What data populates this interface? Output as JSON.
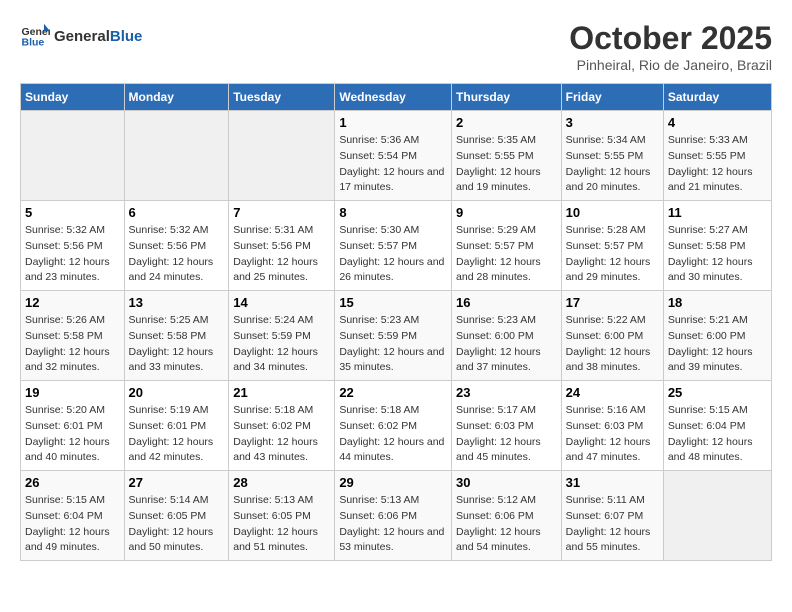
{
  "header": {
    "logo_general": "General",
    "logo_blue": "Blue",
    "title": "October 2025",
    "subtitle": "Pinheiral, Rio de Janeiro, Brazil"
  },
  "calendar": {
    "days_of_week": [
      "Sunday",
      "Monday",
      "Tuesday",
      "Wednesday",
      "Thursday",
      "Friday",
      "Saturday"
    ],
    "weeks": [
      [
        {
          "day": "",
          "info": ""
        },
        {
          "day": "",
          "info": ""
        },
        {
          "day": "",
          "info": ""
        },
        {
          "day": "1",
          "info": "Sunrise: 5:36 AM\nSunset: 5:54 PM\nDaylight: 12 hours and 17 minutes."
        },
        {
          "day": "2",
          "info": "Sunrise: 5:35 AM\nSunset: 5:55 PM\nDaylight: 12 hours and 19 minutes."
        },
        {
          "day": "3",
          "info": "Sunrise: 5:34 AM\nSunset: 5:55 PM\nDaylight: 12 hours and 20 minutes."
        },
        {
          "day": "4",
          "info": "Sunrise: 5:33 AM\nSunset: 5:55 PM\nDaylight: 12 hours and 21 minutes."
        }
      ],
      [
        {
          "day": "5",
          "info": "Sunrise: 5:32 AM\nSunset: 5:56 PM\nDaylight: 12 hours and 23 minutes."
        },
        {
          "day": "6",
          "info": "Sunrise: 5:32 AM\nSunset: 5:56 PM\nDaylight: 12 hours and 24 minutes."
        },
        {
          "day": "7",
          "info": "Sunrise: 5:31 AM\nSunset: 5:56 PM\nDaylight: 12 hours and 25 minutes."
        },
        {
          "day": "8",
          "info": "Sunrise: 5:30 AM\nSunset: 5:57 PM\nDaylight: 12 hours and 26 minutes."
        },
        {
          "day": "9",
          "info": "Sunrise: 5:29 AM\nSunset: 5:57 PM\nDaylight: 12 hours and 28 minutes."
        },
        {
          "day": "10",
          "info": "Sunrise: 5:28 AM\nSunset: 5:57 PM\nDaylight: 12 hours and 29 minutes."
        },
        {
          "day": "11",
          "info": "Sunrise: 5:27 AM\nSunset: 5:58 PM\nDaylight: 12 hours and 30 minutes."
        }
      ],
      [
        {
          "day": "12",
          "info": "Sunrise: 5:26 AM\nSunset: 5:58 PM\nDaylight: 12 hours and 32 minutes."
        },
        {
          "day": "13",
          "info": "Sunrise: 5:25 AM\nSunset: 5:58 PM\nDaylight: 12 hours and 33 minutes."
        },
        {
          "day": "14",
          "info": "Sunrise: 5:24 AM\nSunset: 5:59 PM\nDaylight: 12 hours and 34 minutes."
        },
        {
          "day": "15",
          "info": "Sunrise: 5:23 AM\nSunset: 5:59 PM\nDaylight: 12 hours and 35 minutes."
        },
        {
          "day": "16",
          "info": "Sunrise: 5:23 AM\nSunset: 6:00 PM\nDaylight: 12 hours and 37 minutes."
        },
        {
          "day": "17",
          "info": "Sunrise: 5:22 AM\nSunset: 6:00 PM\nDaylight: 12 hours and 38 minutes."
        },
        {
          "day": "18",
          "info": "Sunrise: 5:21 AM\nSunset: 6:00 PM\nDaylight: 12 hours and 39 minutes."
        }
      ],
      [
        {
          "day": "19",
          "info": "Sunrise: 5:20 AM\nSunset: 6:01 PM\nDaylight: 12 hours and 40 minutes."
        },
        {
          "day": "20",
          "info": "Sunrise: 5:19 AM\nSunset: 6:01 PM\nDaylight: 12 hours and 42 minutes."
        },
        {
          "day": "21",
          "info": "Sunrise: 5:18 AM\nSunset: 6:02 PM\nDaylight: 12 hours and 43 minutes."
        },
        {
          "day": "22",
          "info": "Sunrise: 5:18 AM\nSunset: 6:02 PM\nDaylight: 12 hours and 44 minutes."
        },
        {
          "day": "23",
          "info": "Sunrise: 5:17 AM\nSunset: 6:03 PM\nDaylight: 12 hours and 45 minutes."
        },
        {
          "day": "24",
          "info": "Sunrise: 5:16 AM\nSunset: 6:03 PM\nDaylight: 12 hours and 47 minutes."
        },
        {
          "day": "25",
          "info": "Sunrise: 5:15 AM\nSunset: 6:04 PM\nDaylight: 12 hours and 48 minutes."
        }
      ],
      [
        {
          "day": "26",
          "info": "Sunrise: 5:15 AM\nSunset: 6:04 PM\nDaylight: 12 hours and 49 minutes."
        },
        {
          "day": "27",
          "info": "Sunrise: 5:14 AM\nSunset: 6:05 PM\nDaylight: 12 hours and 50 minutes."
        },
        {
          "day": "28",
          "info": "Sunrise: 5:13 AM\nSunset: 6:05 PM\nDaylight: 12 hours and 51 minutes."
        },
        {
          "day": "29",
          "info": "Sunrise: 5:13 AM\nSunset: 6:06 PM\nDaylight: 12 hours and 53 minutes."
        },
        {
          "day": "30",
          "info": "Sunrise: 5:12 AM\nSunset: 6:06 PM\nDaylight: 12 hours and 54 minutes."
        },
        {
          "day": "31",
          "info": "Sunrise: 5:11 AM\nSunset: 6:07 PM\nDaylight: 12 hours and 55 minutes."
        },
        {
          "day": "",
          "info": ""
        }
      ]
    ]
  }
}
